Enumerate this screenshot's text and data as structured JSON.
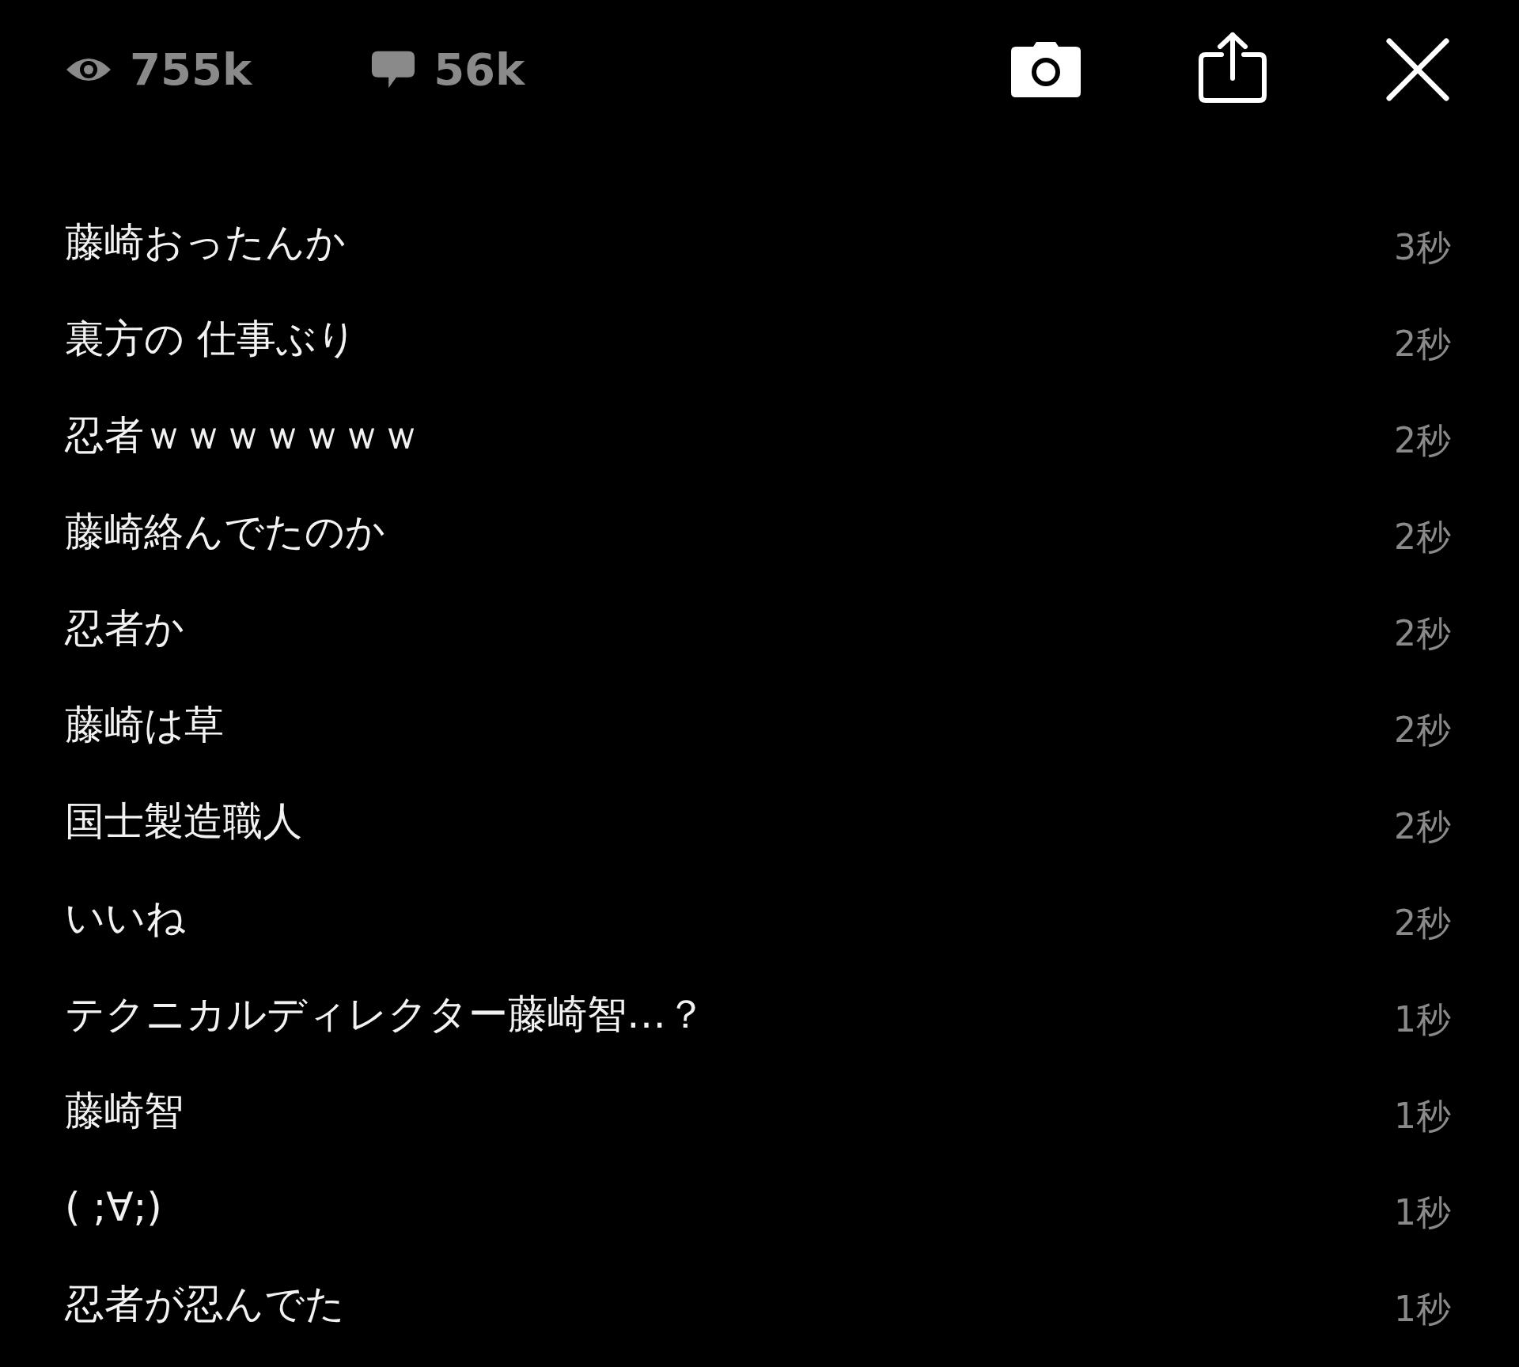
{
  "stats": {
    "views": "755k",
    "comments": "56k"
  },
  "comments": [
    {
      "text": "藤崎おったんか",
      "time": "3秒"
    },
    {
      "text": "裏方の 仕事ぶり",
      "time": "2秒"
    },
    {
      "text": "忍者ｗｗｗｗｗｗｗ",
      "time": "2秒"
    },
    {
      "text": "藤崎絡んでたのか",
      "time": "2秒"
    },
    {
      "text": "忍者か",
      "time": "2秒"
    },
    {
      "text": "藤崎は草",
      "time": "2秒"
    },
    {
      "text": "国士製造職人",
      "time": "2秒"
    },
    {
      "text": "いいね",
      "time": "2秒"
    },
    {
      "text": "テクニカルディレクター藤崎智…？",
      "time": "1秒"
    },
    {
      "text": "藤崎智",
      "time": "1秒"
    },
    {
      "text": "( ;∀;)",
      "time": "1秒"
    },
    {
      "text": "忍者が忍んでた",
      "time": "1秒"
    }
  ]
}
